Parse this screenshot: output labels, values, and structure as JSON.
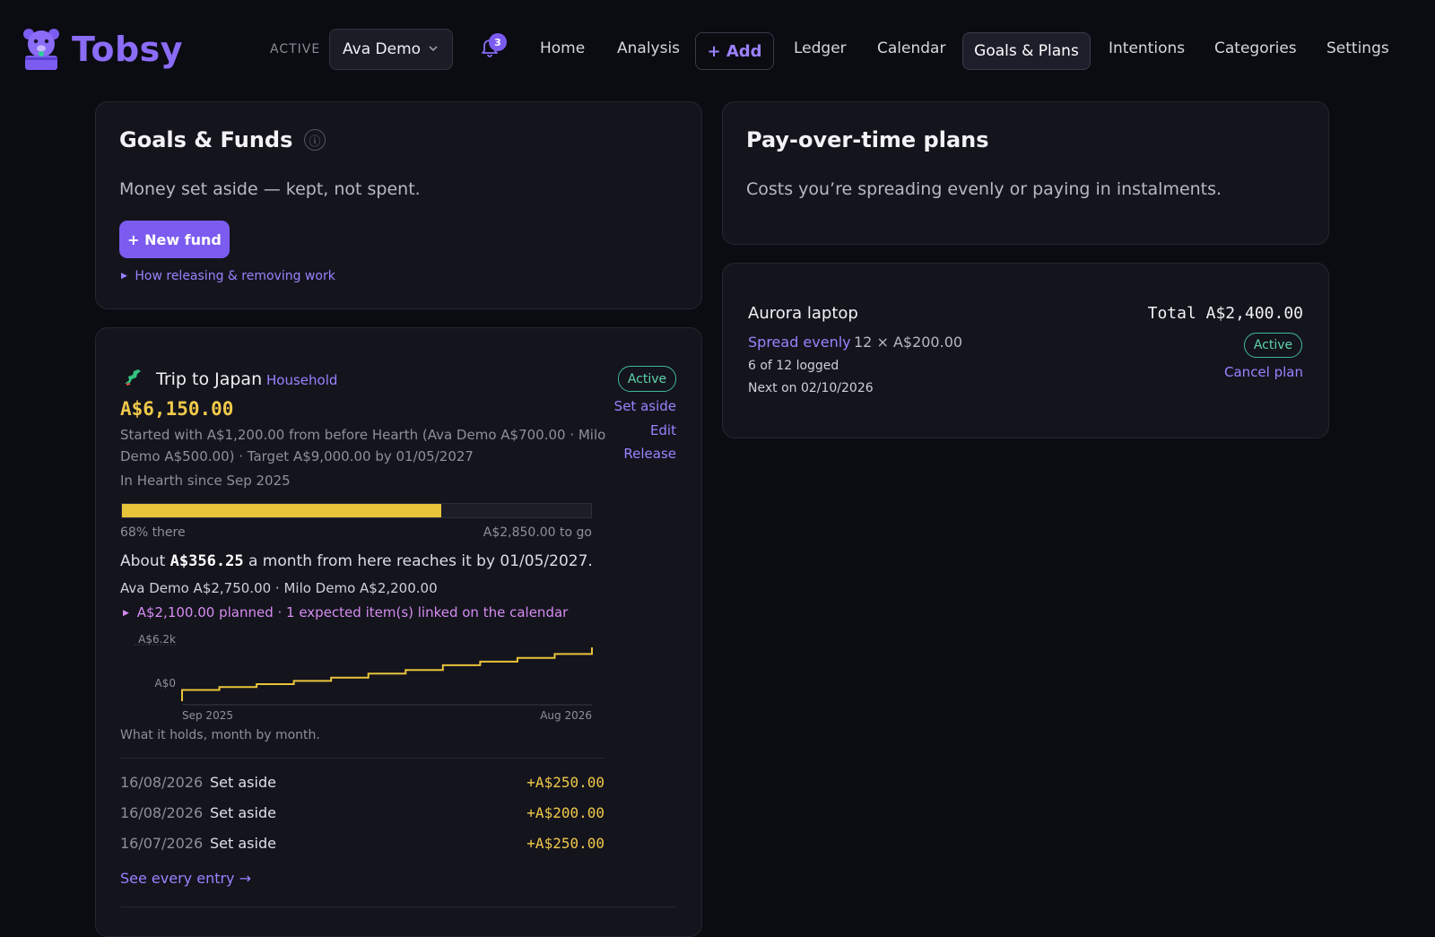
{
  "app": {
    "name": "Tobsy"
  },
  "header": {
    "active_label": "ACTIVE",
    "profile": "Ava Demo",
    "notifications_count": "3",
    "nav": {
      "home": "Home",
      "analysis": "Analysis",
      "add": "+ Add",
      "ledger": "Ledger",
      "calendar": "Calendar",
      "goals": "Goals & Plans",
      "intentions": "Intentions",
      "categories": "Categories",
      "settings": "Settings"
    }
  },
  "goals_panel": {
    "title": "Goals & Funds",
    "info_icon": "ⓘ",
    "subtitle": "Money set aside — kept, not spent.",
    "new_fund_label": "+ New fund",
    "help_link": "How releasing & removing work"
  },
  "fund": {
    "emoji": "🗾",
    "name": "Trip to Japan",
    "tag": "Household",
    "status": "Active",
    "amount": "A$6,150.00",
    "actions": {
      "set_aside": "Set aside",
      "edit": "Edit",
      "release": "Release"
    },
    "details_line1": "Started with A$1,200.00 from before Hearth (Ava Demo A$700.00 · Milo",
    "details_line2": "Demo A$500.00) · Target A$9,000.00 by 01/05/2027",
    "since": "In Hearth since Sep 2025",
    "progress_fraction": 0.68,
    "progress_label": "68% there",
    "to_go": "A$2,850.00 to go",
    "projection_pre": "About ",
    "projection_amount": "A$356.25",
    "projection_post": " a month from here reaches it by 01/05/2027.",
    "contributors": "Ava Demo A$2,750.00 · Milo Demo A$2,200.00",
    "planned": "A$2,100.00 planned · 1 expected item(s) linked on the calendar",
    "chart_caption": "What it holds, month by month.",
    "entries": [
      {
        "date": "16/08/2026",
        "label": "Set aside",
        "amount": "+A$250.00"
      },
      {
        "date": "16/08/2026",
        "label": "Set aside",
        "amount": "+A$200.00"
      },
      {
        "date": "16/07/2026",
        "label": "Set aside",
        "amount": "+A$250.00"
      }
    ],
    "see_all": "See every entry →"
  },
  "chart_data": {
    "type": "line",
    "x": [
      "Sep 2025",
      "Oct 2025",
      "Nov 2025",
      "Dec 2025",
      "Jan 2026",
      "Feb 2026",
      "Mar 2026",
      "Apr 2026",
      "May 2026",
      "Jun 2026",
      "Jul 2026",
      "Aug 2026"
    ],
    "y": [
      300,
      700,
      1100,
      1550,
      2000,
      2550,
      3050,
      3700,
      4200,
      4700,
      5250,
      6150
    ],
    "ylim": [
      0,
      6150
    ],
    "yticks": [
      "A$0",
      "A$6.2k"
    ],
    "xticks": [
      "Sep 2025",
      "Aug 2026"
    ],
    "line_color": "#e8c43a",
    "step": true
  },
  "plans_panel": {
    "title": "Pay-over-time plans",
    "subtitle": "Costs you’re spreading evenly or paying in instalments."
  },
  "plan": {
    "name": "Aurora laptop",
    "total": "Total A$2,400.00",
    "type": "Spread evenly",
    "schedule": "12 × A$200.00",
    "logged": "6 of 12 logged",
    "next": "Next on 02/10/2026",
    "status": "Active",
    "cancel": "Cancel plan"
  },
  "colors": {
    "accent": "#7c5cf0",
    "gold": "#e8c43a",
    "active_green": "#5ed4ac",
    "planned_pink": "#d58cf0"
  }
}
